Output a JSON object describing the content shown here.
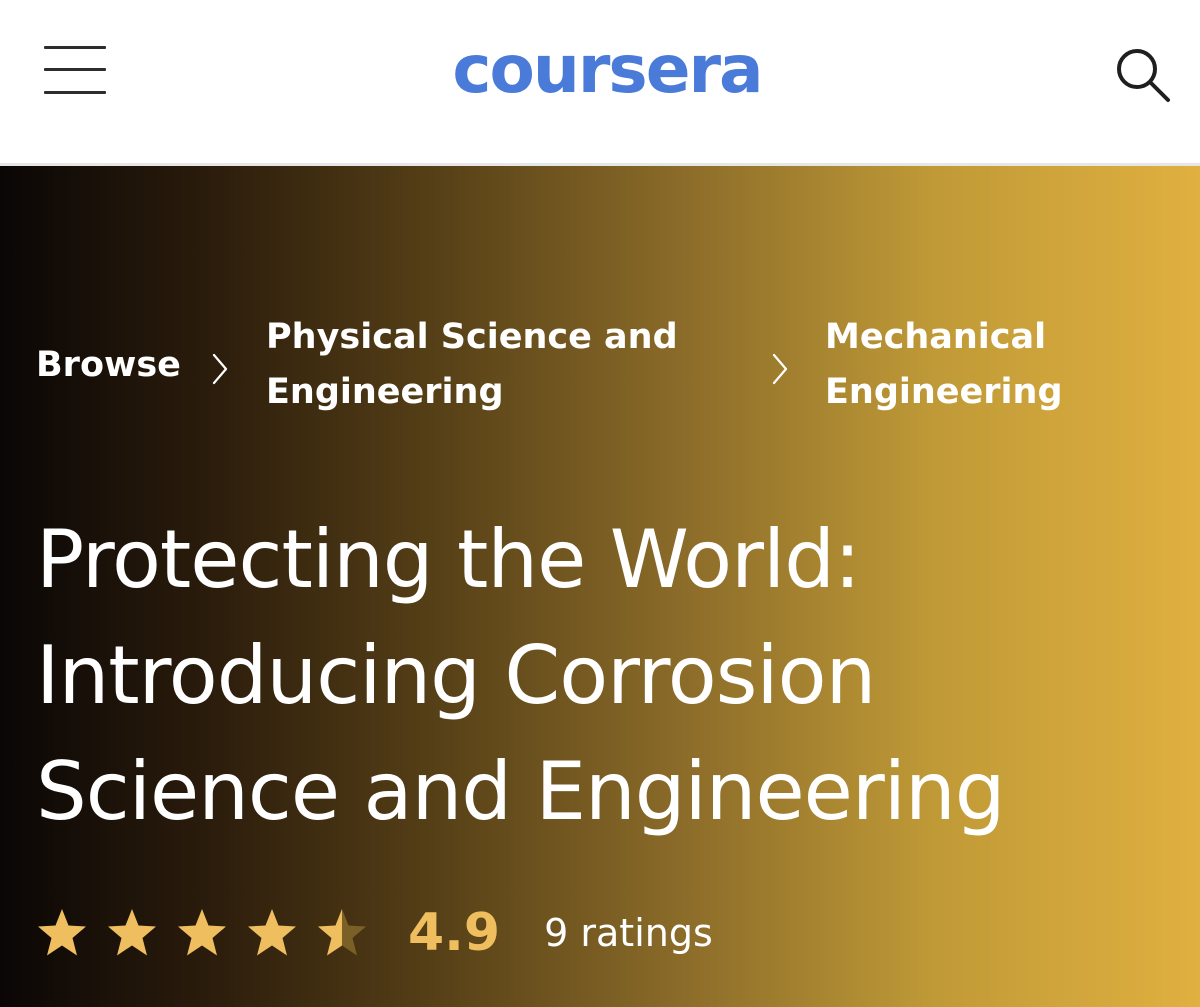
{
  "header": {
    "logo_text": "coursera",
    "brand_color": "#4a7bd8",
    "menu_icon": "hamburger-menu-icon",
    "search_icon": "search-icon"
  },
  "breadcrumb": {
    "items": [
      {
        "label": "Browse"
      },
      {
        "label": "Physical Science and Engineering"
      },
      {
        "label": "Mechanical Engineering"
      }
    ],
    "separator_icon": "chevron-right-icon"
  },
  "course": {
    "title": "Protecting the World: Introducing Corrosion Science and Engineering",
    "rating": "4.9",
    "rating_out_of": 5,
    "rating_count": "9 ratings",
    "star_color": "#efbe5e"
  }
}
